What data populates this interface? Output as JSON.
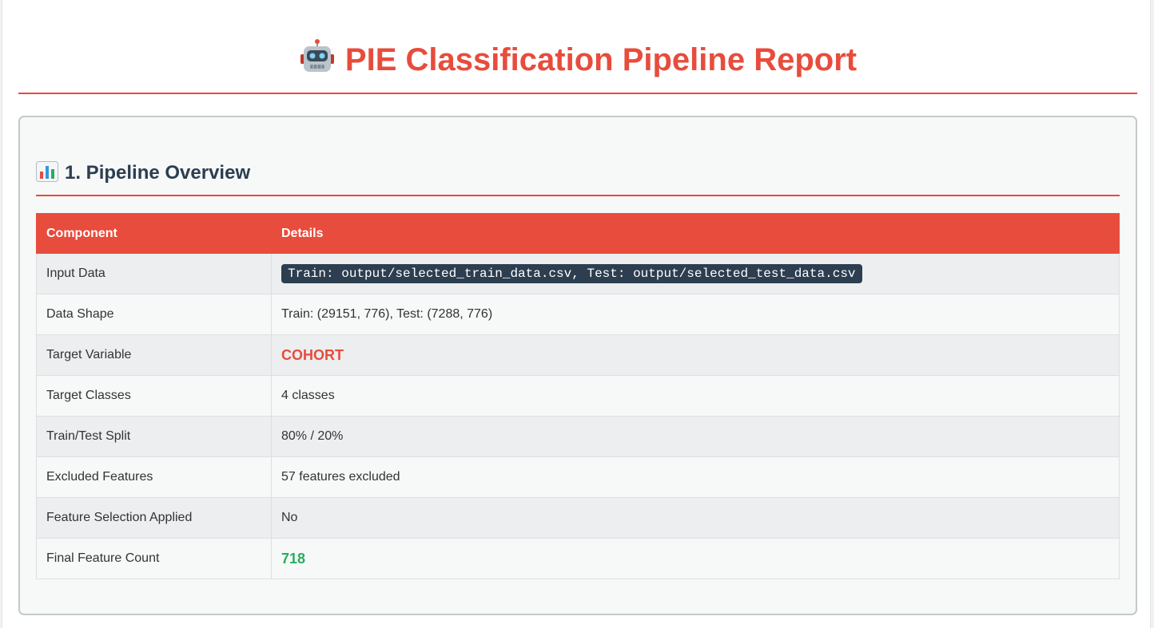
{
  "header": {
    "title": "PIE Classification Pipeline Report",
    "title_icon": "robot-icon"
  },
  "section": {
    "heading": "1. Pipeline Overview",
    "heading_icon": "bar-chart-icon"
  },
  "table": {
    "columns": [
      "Component",
      "Details"
    ],
    "rows": [
      {
        "component": "Input Data",
        "details": "Train: output/selected_train_data.csv, Test: output/selected_test_data.csv",
        "style": "code"
      },
      {
        "component": "Data Shape",
        "details": "Train: (29151, 776), Test: (7288, 776)",
        "style": "plain"
      },
      {
        "component": "Target Variable",
        "details": "COHORT",
        "style": "highlight-red"
      },
      {
        "component": "Target Classes",
        "details": "4 classes",
        "style": "plain"
      },
      {
        "component": "Train/Test Split",
        "details": "80% / 20%",
        "style": "plain"
      },
      {
        "component": "Excluded Features",
        "details": "57 features excluded",
        "style": "plain"
      },
      {
        "component": "Feature Selection Applied",
        "details": "No",
        "style": "plain"
      },
      {
        "component": "Final Feature Count",
        "details": "718",
        "style": "highlight-green"
      }
    ]
  },
  "colors": {
    "accent": "#e74c3c",
    "heading": "#2c3e50",
    "success": "#27ae60",
    "code_bg": "#2c3e50"
  }
}
